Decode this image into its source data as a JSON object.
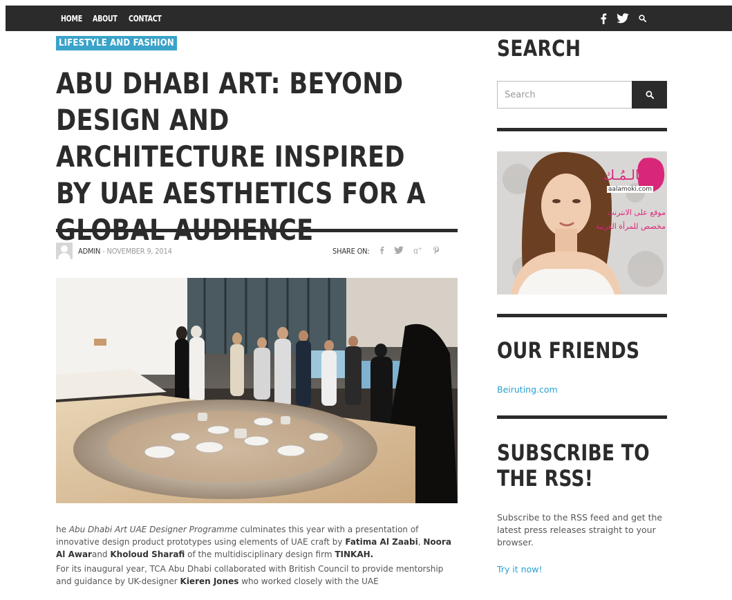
{
  "nav": {
    "items": [
      "HOME",
      "ABOUT",
      "CONTACT"
    ]
  },
  "social": {
    "icons": [
      "facebook-icon",
      "twitter-icon",
      "search-icon"
    ]
  },
  "article": {
    "category": "LIFESTYLE AND FASHION",
    "title": "ABU DHABI ART: BEYOND DESIGN AND ARCHITECTURE INSPIRED BY UAE AESTHETICS FOR A GLOBAL AUDIENCE",
    "author": "ADMIN",
    "separator": " - ",
    "date": "NOVEMBER 9, 2014",
    "share_label": "SHARE ON:",
    "share_icons": [
      "facebook-icon",
      "twitter-icon",
      "google-plus-icon",
      "pinterest-icon"
    ],
    "p1": {
      "s1": "he ",
      "em1": "Abu Dhabi Art UAE Designer Programme",
      "s2": " culminates this year with a presentation of innovative design product prototypes using elements of UAE craft by ",
      "b1": "Fatima Al Zaabi",
      "s3": ", ",
      "b2": "Noora Al Awar",
      "s4": "and ",
      "b3": "Kholoud Sharafi",
      "s5": " of the multidisciplinary design firm ",
      "b4": "TINKAH.",
      "s6": ""
    },
    "p2": {
      "s1": "For its inaugural year, TCA Abu Dhabi collaborated with British Council to provide mentorship and guidance by UK-designer ",
      "b1": "Kieren Jones",
      "s2": " who worked closely with the UAE"
    }
  },
  "sidebar": {
    "search_title": "SEARCH",
    "search_placeholder": "Search",
    "ad": {
      "brand_arabic": "عالـمُـك",
      "brand_latin": "aalamoki.com",
      "line1": "موقع على الانترنت",
      "line2": "مخصص للمرأة العربية"
    },
    "friends_title": "OUR FRIENDS",
    "friends_link": "Beiruting.com",
    "rss_title_1": "SUBSCRIBE TO",
    "rss_title_2": "THE RSS!",
    "rss_text": "Subscribe to the RSS feed and get the latest press releases straight to your browser.",
    "rss_link": "Try it now!"
  },
  "colors": {
    "dark": "#2b2b2b",
    "accent": "#3aa3c9",
    "link": "#2a9fd0"
  }
}
